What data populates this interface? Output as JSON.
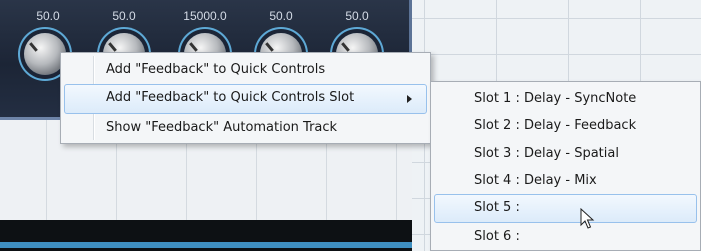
{
  "plugin": {
    "values": [
      "50.0",
      "50.0",
      "15000.0",
      "50.0",
      "50.0"
    ]
  },
  "context_menu": {
    "items": [
      {
        "label": "Add \"Feedback\" to Quick Controls"
      },
      {
        "label": "Add \"Feedback\" to Quick Controls Slot",
        "has_submenu": true,
        "highlighted": true
      },
      {
        "label": "Show \"Feedback\" Automation Track"
      }
    ]
  },
  "submenu": {
    "items": [
      {
        "label": "Slot 1 : Delay - SyncNote"
      },
      {
        "label": "Slot 2 : Delay - Feedback"
      },
      {
        "label": "Slot 3 : Delay - Spatial"
      },
      {
        "label": "Slot 4 : Delay - Mix"
      },
      {
        "label": "Slot 5 :",
        "highlighted": true
      },
      {
        "label": "Slot 6 :"
      }
    ]
  },
  "colors": {
    "panel_bg": "#1c2536",
    "knob_ring": "#5ea9d6",
    "menu_highlight": "#dcebfa",
    "menu_highlight_border": "#98c1ec"
  },
  "icons": {
    "submenu_arrow": "chevron-right-icon",
    "cursor": "mouse-pointer-icon"
  }
}
